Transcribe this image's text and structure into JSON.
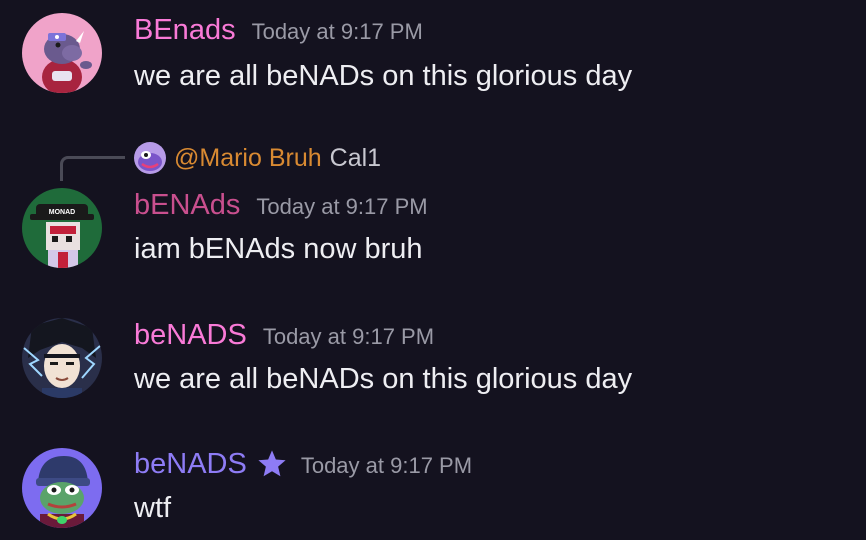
{
  "colors": {
    "background": "#14121f",
    "username_pink": "#f97ad7",
    "username_magenta": "#c94f8e",
    "username_violet": "#8e7cf5",
    "mention_orange": "#d98a32",
    "timestamp": "#9a9aa6",
    "text": "#eeeef2"
  },
  "messages": [
    {
      "username": "BEnads",
      "timestamp": "Today at 9:17 PM",
      "content": "we are all beNADs on this glorious day",
      "avatar_icon": "purple-rhino-avatar"
    },
    {
      "reply": {
        "mention": "@Mario Bruh",
        "text": "Cal1",
        "avatar_icon": "purple-creature-avatar"
      },
      "username": "bENAds",
      "timestamp": "Today at 9:17 PM",
      "content": "iam bENAds now bruh",
      "avatar_icon": "pixel-monad-hat-avatar",
      "avatar_text": "MONAD"
    },
    {
      "username": "beNADS",
      "timestamp": "Today at 9:17 PM",
      "content": "we are all beNADs on this glorious day",
      "avatar_icon": "anime-lightning-avatar"
    },
    {
      "username": "beNADS",
      "timestamp": "Today at 9:17 PM",
      "content": "wtf",
      "avatar_icon": "pepe-beanie-avatar",
      "badge_icon": "star-icon"
    }
  ]
}
